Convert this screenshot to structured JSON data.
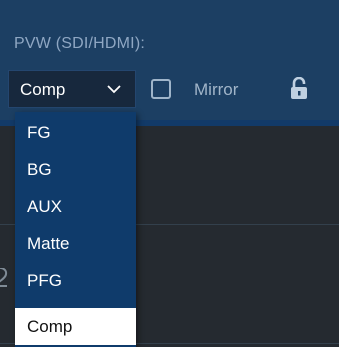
{
  "preview": {
    "label": "PVW (SDI/HDMI):",
    "source_select": {
      "value": "Comp",
      "options": [
        "FG",
        "BG",
        "AUX",
        "Matte",
        "PFG",
        "Comp"
      ],
      "selected": "Comp"
    },
    "mirror_checkbox": {
      "label": "Mirror",
      "checked": false
    },
    "lock_icon": "padlock-open"
  },
  "colors": {
    "header_background": "#1c3f63",
    "panel_background": "#252a30",
    "dropdown_background": "#0f3b6b",
    "selected_option_background": "#ffffff",
    "text": "#ffffff",
    "muted_text": "#8fa7c3"
  }
}
